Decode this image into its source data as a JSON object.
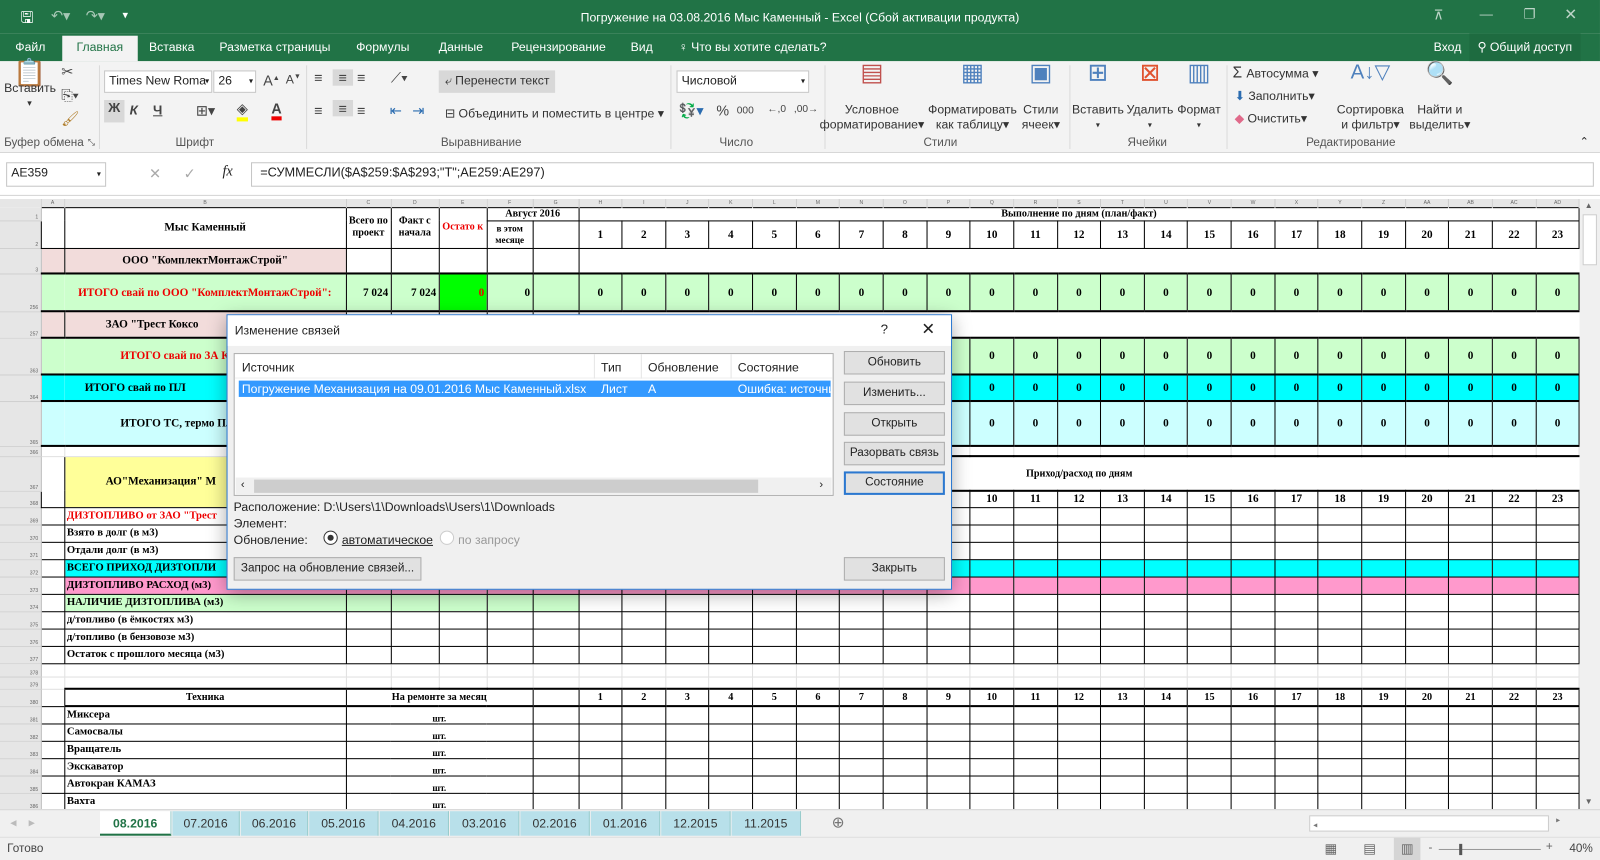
{
  "window": {
    "title": "Погружение на 03.08.2016 Мыс Каменный - Excel (Сбой активации продукта)"
  },
  "tabs": [
    "Файл",
    "Главная",
    "Вставка",
    "Разметка страницы",
    "Формулы",
    "Данные",
    "Рецензирование",
    "Вид"
  ],
  "tell_me": "Что вы хотите сделать?",
  "signin": "Вход",
  "share": "Общий доступ",
  "ribbon": {
    "clipboard": {
      "paste": "Вставить",
      "group": "Буфер обмена"
    },
    "font": {
      "name": "Times New Roma",
      "size": "26",
      "bold": "Ж",
      "italic": "К",
      "underline": "Ч",
      "group": "Шрифт",
      "text_color": "#e00000",
      "fill_color": "#ffff00"
    },
    "alignment": {
      "wrap": "Перенести текст",
      "merge": "Объединить и поместить в центре",
      "group": "Выравнивание"
    },
    "number": {
      "format": "Числовой",
      "percent": "%",
      "thousands": "000",
      "group": "Число"
    },
    "styles": {
      "conditional": [
        "Условное",
        "форматирование"
      ],
      "as_table": [
        "Форматировать",
        "как таблицу"
      ],
      "cell_styles": [
        "Стили",
        "ячеек"
      ],
      "group": "Стили"
    },
    "cells": {
      "insert": "Вставить",
      "delete": "Удалить",
      "format": "Формат",
      "group": "Ячейки"
    },
    "editing": {
      "autosum": "Автосумма",
      "fill": "Заполнить",
      "clear": "Очистить",
      "sort": [
        "Сортировка",
        "и фильтр"
      ],
      "find": [
        "Найти и",
        "выделить"
      ],
      "group": "Редактирование"
    }
  },
  "formula_bar": {
    "name_box": "AE359",
    "formula": "=СУММЕСЛИ($A$259:$A$293;\"Т\";AE259:AE297)"
  },
  "sheet": {
    "columns": [
      "A",
      "B",
      "C",
      "D",
      "E",
      "F",
      "G",
      "H",
      "I",
      "J",
      "K",
      "L",
      "M",
      "N",
      "O",
      "P",
      "Q",
      "R",
      "S",
      "T",
      "U",
      "V",
      "W",
      "X",
      "Y",
      "Z",
      "AA",
      "AB",
      "AC",
      "AD"
    ],
    "header": {
      "title": "Мыс Каменный",
      "total": "Всего по проект",
      "fact": "Факт с начала",
      "rest": "Остато к",
      "month": "Август 2016",
      "this_month": "в этом месяце",
      "days_caption": "Выполнение по дням (план/факт)"
    },
    "days": [
      "1",
      "2",
      "3",
      "4",
      "5",
      "6",
      "7",
      "8",
      "9",
      "10",
      "11",
      "12",
      "13",
      "14",
      "15",
      "16",
      "17",
      "18",
      "19",
      "20",
      "21",
      "22",
      "23"
    ],
    "rows": [
      {
        "num": "3",
        "kind": "title",
        "label": "ООО \"КомплектМонтажСтрой\""
      },
      {
        "num": "256",
        "kind": "total",
        "style": "green",
        "label": "ИТОГО свай по ООО \"КомплектМонтажСтрой\":",
        "vals": [
          "7 024",
          "7 024",
          "0",
          "0",
          ""
        ],
        "day_val": "0"
      },
      {
        "num": "257",
        "kind": "title",
        "label": "ЗАО \"Трест Коксо"
      },
      {
        "num": "363",
        "kind": "total",
        "style": "green",
        "label": "ИТОГО свай по ЗА Коксохиммонт",
        "vals": [
          "",
          "",
          "",
          "",
          ""
        ],
        "day_val": "0"
      },
      {
        "num": "364",
        "kind": "total",
        "style": "cyan",
        "label": "ИТОГО свай по ПЛ",
        "vals": [
          "",
          "",
          "",
          "",
          ""
        ],
        "day_val": "0"
      },
      {
        "num": "365",
        "kind": "total",
        "style": "lcyan",
        "label": "ИТОГО ТС, термо ПЛОЩАДИ",
        "vals": [
          "",
          "",
          "",
          "",
          ""
        ],
        "day_val": "0"
      },
      {
        "num": "366",
        "kind": "blank"
      },
      {
        "num": "367",
        "kind": "mech",
        "label": "АО\"Механизация\" М",
        "caption": "Приход/расход по дням"
      },
      {
        "num": "368",
        "kind": "mech2"
      },
      {
        "num": "369",
        "kind": "fuel",
        "label": "ДИЗТОПЛИВО от ЗАО \"Трест",
        "style": "red"
      },
      {
        "num": "370",
        "kind": "fuel",
        "label": "Взято в долг (в м3)"
      },
      {
        "num": "371",
        "kind": "fuel",
        "label": "Отдали долг (в м3)"
      },
      {
        "num": "372",
        "kind": "fuel",
        "label": "ВСЕГО ПРИХОД ДИЗТОПЛИ",
        "style": "cyan"
      },
      {
        "num": "373",
        "kind": "fuel",
        "label": "ДИЗТОПЛИВО РАСХОД (м3)",
        "style": "rose"
      },
      {
        "num": "374",
        "kind": "fuel",
        "label": "НАЛИЧИЕ ДИЗТОПЛИВА (м3)",
        "style": "green"
      },
      {
        "num": "375",
        "kind": "fuel",
        "label": "д/топливо (в ёмкостях м3)"
      },
      {
        "num": "376",
        "kind": "fuel",
        "label": "д/топливо (в бензовозе м3)"
      },
      {
        "num": "377",
        "kind": "fuel",
        "label": "Остаток с прошлого месяца (м3)"
      },
      {
        "num": "378",
        "kind": "blank"
      },
      {
        "num": "379",
        "kind": "blank"
      },
      {
        "num": "380",
        "kind": "techhead",
        "label": "Техника",
        "repair": "На ремонте за месяц"
      },
      {
        "num": "381",
        "kind": "tech",
        "label": "Миксера",
        "unit": "шт."
      },
      {
        "num": "382",
        "kind": "tech",
        "label": "Самосвалы",
        "unit": "шт."
      },
      {
        "num": "383",
        "kind": "tech",
        "label": "Вращатель",
        "unit": "шт."
      },
      {
        "num": "384",
        "kind": "tech",
        "label": "Экскаватор",
        "unit": "шт."
      },
      {
        "num": "385",
        "kind": "tech",
        "label": "Автокран  КАМАЗ",
        "unit": "шт."
      },
      {
        "num": "386",
        "kind": "tech",
        "label": "Вахта",
        "unit": "шт."
      }
    ]
  },
  "sheet_tabs": [
    "08.2016",
    "07.2016",
    "06.2016",
    "05.2016",
    "04.2016",
    "03.2016",
    "02.2016",
    "01.2016",
    "12.2015",
    "11.2015"
  ],
  "status": {
    "ready": "Готово",
    "zoom": "40%",
    "zoom_fraction": 0.4
  },
  "dialog": {
    "title": "Изменение связей",
    "help": "?",
    "columns": [
      "Источник",
      "Тип",
      "Обновление",
      "Состояние"
    ],
    "links": [
      {
        "source": "Погружение Механизация на 09.01.2016 Мыс Каменный.xlsx",
        "type": "Лист",
        "update": "A",
        "status": "Ошибка: источни"
      }
    ],
    "location_label": "Расположение:",
    "location": "D:\\Users\\1\\Downloads\\Users\\1\\Downloads",
    "element_label": "Элемент:",
    "update_label": "Обновление:",
    "auto": "автоматическое",
    "manual": "по запросу",
    "buttons": {
      "update": "Обновить",
      "change": "Изменить...",
      "open": "Открыть",
      "break": "Разорвать связь",
      "status": "Состояние",
      "close": "Закрыть",
      "startup": "Запрос на обновление связей..."
    },
    "selection_color": "#3399ff"
  }
}
